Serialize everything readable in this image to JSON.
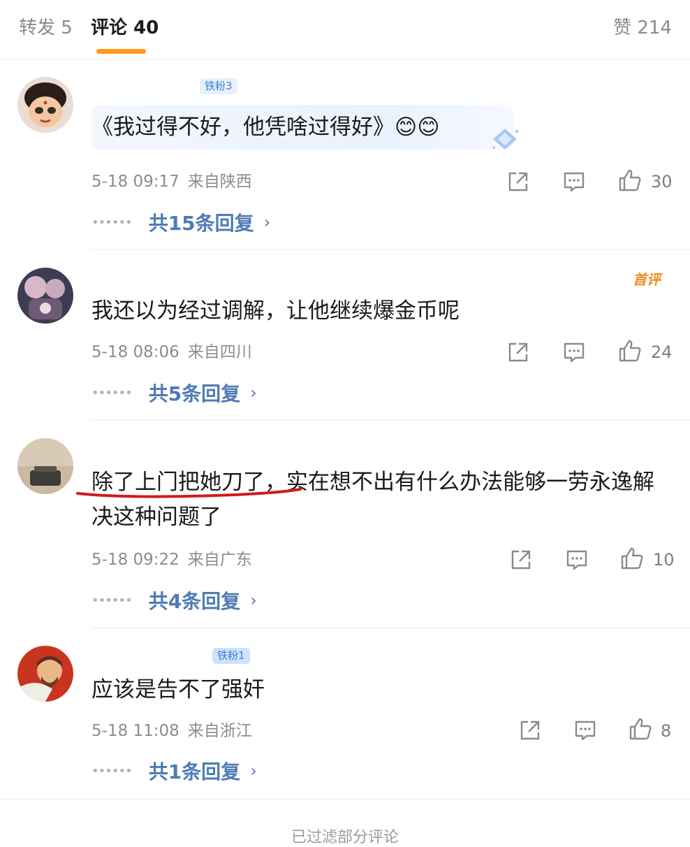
{
  "tabs": {
    "repost": "转发 5",
    "comments": "评论 40",
    "likes": "赞 214"
  },
  "comments": [
    {
      "username": "",
      "fan_badge": "铁粉3",
      "text": "《我过得不好，他凭啥过得好》😊😊",
      "time": "5-18 09:17",
      "location": "来自陕西",
      "likes": "30",
      "replies": "共15条回复"
    },
    {
      "username": "",
      "tag": "首评",
      "text": "我还以为经过调解，让他继续爆金币呢",
      "time": "5-18 08:06",
      "location": "来自四川",
      "likes": "24",
      "replies": "共5条回复"
    },
    {
      "username": "",
      "text_underlined": "除了上门把她刀了",
      "text_rest": "，实在想不出有什么办法能够一劳永逸解决这种问题了",
      "time": "5-18 09:22",
      "location": "来自广东",
      "likes": "10",
      "replies": "共4条回复"
    },
    {
      "username": "",
      "fan_badge": "铁粉1",
      "text": "应该是告不了强奸",
      "time": "5-18 11:08",
      "location": "来自浙江",
      "likes": "8",
      "replies": "共1条回复"
    }
  ],
  "footer": "已过滤部分评论",
  "colors": {
    "accent_underline": "#ff9b1e",
    "link_blue": "#4f7bb4",
    "top_comment_orange": "#f08a1e",
    "annotation_red": "#d11b1b"
  },
  "icons": [
    "share-icon",
    "comment-icon",
    "thumb-up-icon",
    "chevron-right-icon",
    "diamond-icon"
  ]
}
